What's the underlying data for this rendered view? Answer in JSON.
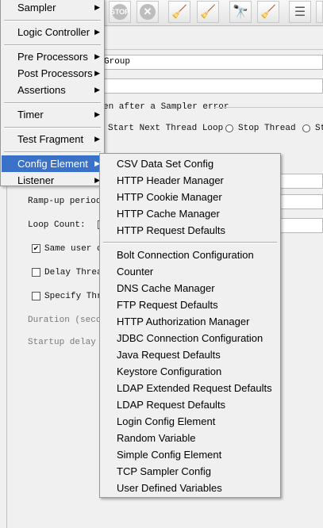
{
  "main_menu": {
    "items": [
      {
        "label": "Sampler",
        "has_submenu": true
      },
      {
        "label": "Logic Controller",
        "has_submenu": true
      },
      {
        "label": "Pre Processors",
        "has_submenu": true
      },
      {
        "label": "Post Processors",
        "has_submenu": true
      },
      {
        "label": "Assertions",
        "has_submenu": true
      },
      {
        "label": "Timer",
        "has_submenu": true
      },
      {
        "label": "Test Fragment",
        "has_submenu": true
      },
      {
        "label": "Config Element",
        "has_submenu": true,
        "active": true
      },
      {
        "label": "Listener",
        "has_submenu": true
      }
    ],
    "arrow_glyph": "▶"
  },
  "config_submenu": {
    "group1": [
      "CSV Data Set Config",
      "HTTP Header Manager",
      "HTTP Cookie Manager",
      "HTTP Cache Manager",
      "HTTP Request Defaults"
    ],
    "group2": [
      "Bolt Connection Configuration",
      "Counter",
      "DNS Cache Manager",
      "FTP Request Defaults",
      "HTTP Authorization Manager",
      "JDBC Connection Configuration",
      "Java Request Defaults",
      "Keystore Configuration",
      "LDAP Extended Request Defaults",
      "LDAP Request Defaults",
      "Login Config Element",
      "Random Variable",
      "Simple Config Element",
      "TCP Sampler Config",
      "User Defined Variables"
    ]
  },
  "thread_group": {
    "name_value": "Group",
    "error_legend": "en after a Sampler error",
    "on_error_options": [
      "Start Next Thread Loop",
      "Stop Thread",
      "St"
    ],
    "rampup_label": "Ramp-up period",
    "loop_label": "Loop Count:",
    "same_user_label": "Same user on",
    "delay_label": "Delay Threa",
    "specify_label": "Specify Thre",
    "duration_label": "Duration (secon",
    "startup_label": "Startup delay ("
  },
  "toolbar": {
    "icons": [
      "stop-icon",
      "shutdown-icon",
      "clear-icon",
      "clear-all-icon",
      "search-icon",
      "reset-search-icon",
      "function-helper-icon"
    ]
  },
  "colors": {
    "menu_highlight": "#3a72c9",
    "menu_bg": "#f0f0f0"
  }
}
